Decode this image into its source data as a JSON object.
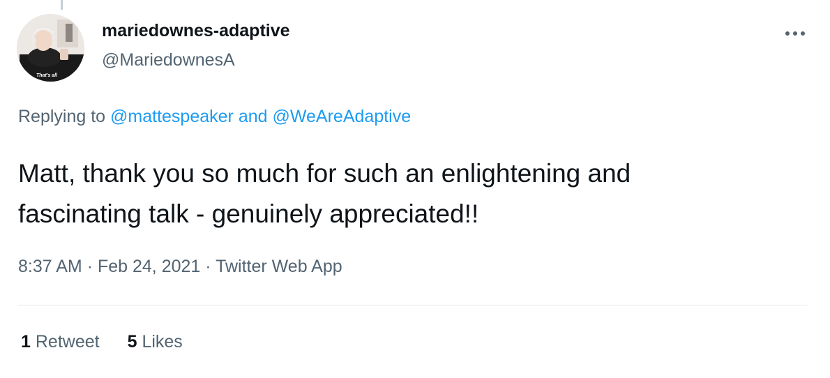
{
  "user": {
    "display_name": "mariedownes-adaptive",
    "handle": "@MariedownesA",
    "avatar_caption": "That's all"
  },
  "reply": {
    "prefix": "Replying to",
    "mention_1": "@mattespeaker",
    "conjunction": "and",
    "mention_2": "@WeAreAdaptive"
  },
  "tweet": {
    "line_1": "Matt, thank you so much for such an enlightening and",
    "line_2": "fascinating talk - genuinely appreciated!!"
  },
  "meta": {
    "time": "8:37 AM",
    "separator": "·",
    "date": "Feb 24, 2021",
    "source": "Twitter Web App"
  },
  "stats": {
    "retweets_count": "1",
    "retweets_label": "Retweet",
    "likes_count": "5",
    "likes_label": "Likes"
  },
  "icons": {
    "more": "more-horizontal-icon"
  },
  "colors": {
    "text_primary": "#0f1419",
    "text_secondary": "#536471",
    "accent": "#1d9bf0",
    "divider": "#e3e8eb"
  }
}
